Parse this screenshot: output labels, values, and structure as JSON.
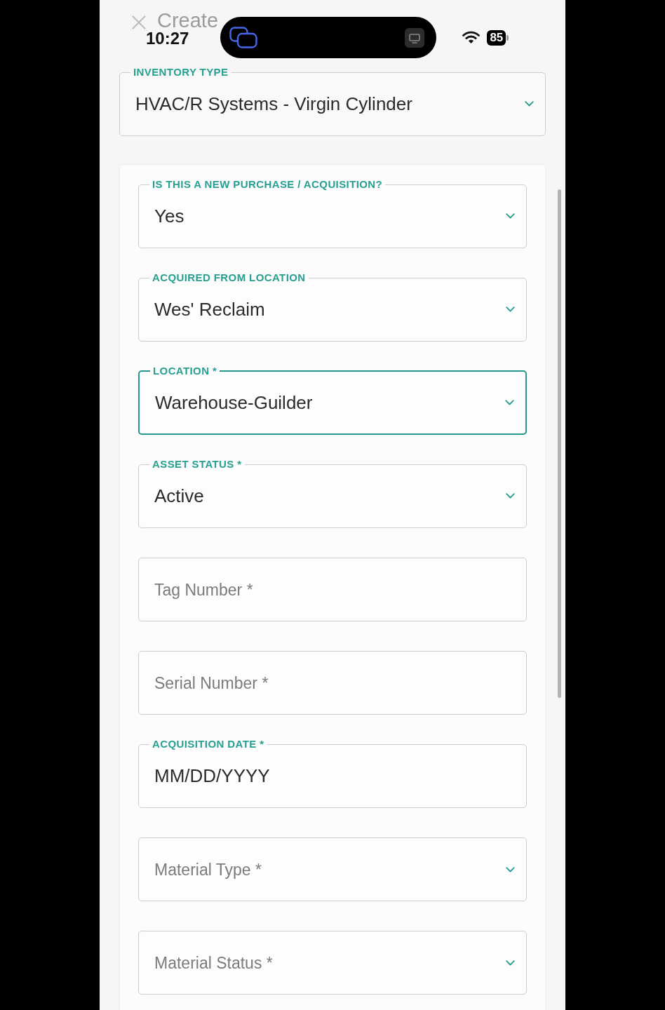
{
  "header": {
    "title": "Create"
  },
  "status_bar": {
    "time": "10:27",
    "battery": "85"
  },
  "inventory_type": {
    "label": "INVENTORY TYPE",
    "value": "HVAC/R Systems - Virgin Cylinder"
  },
  "fields": [
    {
      "kind": "select",
      "label": "IS THIS A NEW PURCHASE / ACQUISITION?",
      "value": "Yes",
      "focused": false
    },
    {
      "kind": "select",
      "label": "ACQUIRED FROM LOCATION",
      "value": "Wes' Reclaim",
      "focused": false
    },
    {
      "kind": "select",
      "label": "LOCATION *",
      "value": "Warehouse-Guilder",
      "focused": true
    },
    {
      "kind": "select",
      "label": "ASSET STATUS *",
      "value": "Active",
      "focused": false
    },
    {
      "kind": "text",
      "placeholder": "Tag Number *",
      "focused": false
    },
    {
      "kind": "text",
      "placeholder": "Serial Number *",
      "focused": false
    },
    {
      "kind": "date",
      "label": "ACQUISITION DATE *",
      "value": "MM/DD/YYYY",
      "focused": false
    },
    {
      "kind": "select",
      "placeholder": "Material Type *",
      "focused": false
    },
    {
      "kind": "select",
      "placeholder": "Material Status *",
      "focused": false
    }
  ]
}
